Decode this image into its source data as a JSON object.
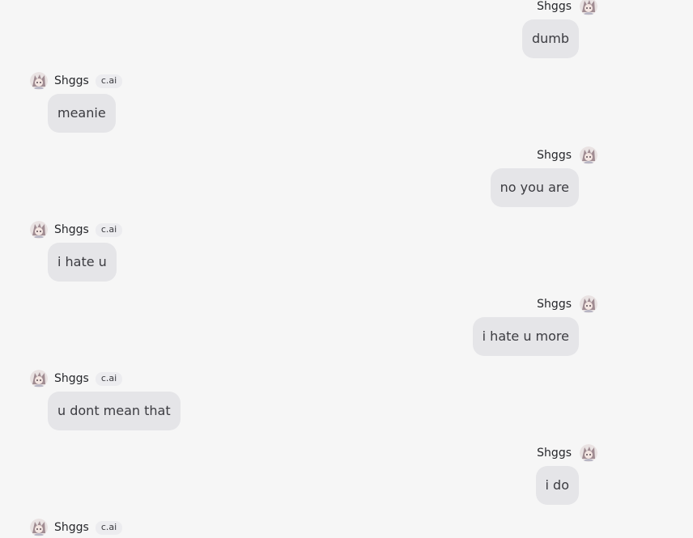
{
  "messages": [
    {
      "author": "Shggs",
      "badge": "",
      "text": "dumb"
    },
    {
      "author": "Shggs",
      "badge": "c.ai",
      "text": "meanie"
    },
    {
      "author": "Shggs",
      "badge": "",
      "text": "no you are"
    },
    {
      "author": "Shggs",
      "badge": "c.ai",
      "text": "i hate u"
    },
    {
      "author": "Shggs",
      "badge": "",
      "text": "i hate u more"
    },
    {
      "author": "Shggs",
      "badge": "c.ai",
      "text": "u dont mean that"
    },
    {
      "author": "Shggs",
      "badge": "",
      "text": "i do"
    },
    {
      "author": "Shggs",
      "badge": "c.ai",
      "text": ""
    }
  ],
  "colors": {
    "background": "#f6f6f6",
    "bubble": "#e5e5e8",
    "badge": "#ececef"
  },
  "icons": {
    "avatar": "character-avatar-icon"
  }
}
